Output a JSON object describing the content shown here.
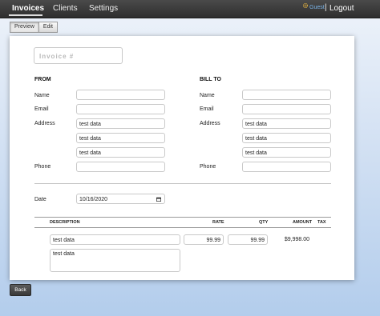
{
  "nav": {
    "items": [
      {
        "label": "Invoices",
        "active": true
      },
      {
        "label": "Clients",
        "active": false
      },
      {
        "label": "Settings",
        "active": false
      }
    ],
    "user": "Guest",
    "separator": "|",
    "logout": "Logout",
    "gear_icon": "gear-icon"
  },
  "toolbar": {
    "preview_label": "Preview",
    "edit_label": "Edit"
  },
  "invoice": {
    "number_placeholder": "Invoice #",
    "from": {
      "heading": "FROM",
      "name_label": "Name",
      "email_label": "Email",
      "address_label": "Address",
      "phone_label": "Phone",
      "name": "",
      "email": "",
      "address1": "test data",
      "address2": "test data",
      "address3": "test data",
      "phone": ""
    },
    "bill_to": {
      "heading": "BILL TO",
      "name_label": "Name",
      "email_label": "Email",
      "address_label": "Address",
      "phone_label": "Phone",
      "name": "",
      "email": "",
      "address1": "test data",
      "address2": "test data",
      "address3": "test data",
      "phone": ""
    },
    "date_label": "Date",
    "date_value": "10/16/2020",
    "columns": {
      "description": "DESCRIPTION",
      "rate": "RATE",
      "qty": "QTY",
      "amount": "AMOUNT",
      "tax": "TAX"
    },
    "line_items": [
      {
        "description": "test data",
        "notes": "test data",
        "rate": "99.99",
        "qty": "99.99",
        "amount": "$9,998.00"
      }
    ]
  },
  "back_label": "Back",
  "colors": {
    "topbar": "#2e2e2e",
    "guest_link": "#7ab3e6",
    "background_bottom": "#b3cdec"
  }
}
